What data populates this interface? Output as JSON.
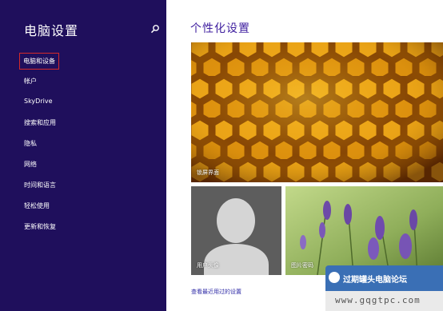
{
  "sidebar": {
    "title": "电脑设置",
    "search_icon": "search-icon",
    "items": [
      {
        "label": "电脑和设备",
        "selected": true
      },
      {
        "label": "帐户",
        "selected": false
      },
      {
        "label": "SkyDrive",
        "selected": false
      },
      {
        "label": "搜索和应用",
        "selected": false
      },
      {
        "label": "隐私",
        "selected": false
      },
      {
        "label": "网络",
        "selected": false
      },
      {
        "label": "时间和语言",
        "selected": false
      },
      {
        "label": "轻松使用",
        "selected": false
      },
      {
        "label": "更新和恢复",
        "selected": false
      }
    ]
  },
  "main": {
    "title": "个性化设置",
    "tiles": {
      "lock_screen": "锁屏界面",
      "account_picture": "用户头像",
      "picture_password": "图片密码"
    },
    "recent_link": "查看最近用过的设置"
  },
  "watermark": {
    "line1": "过期罐头电脑论坛",
    "line2": "www.gqgtpc.com"
  },
  "colors": {
    "sidebar_bg": "#1f0f5c",
    "accent": "#3f1f9f",
    "selection_border": "#d42a2a"
  }
}
